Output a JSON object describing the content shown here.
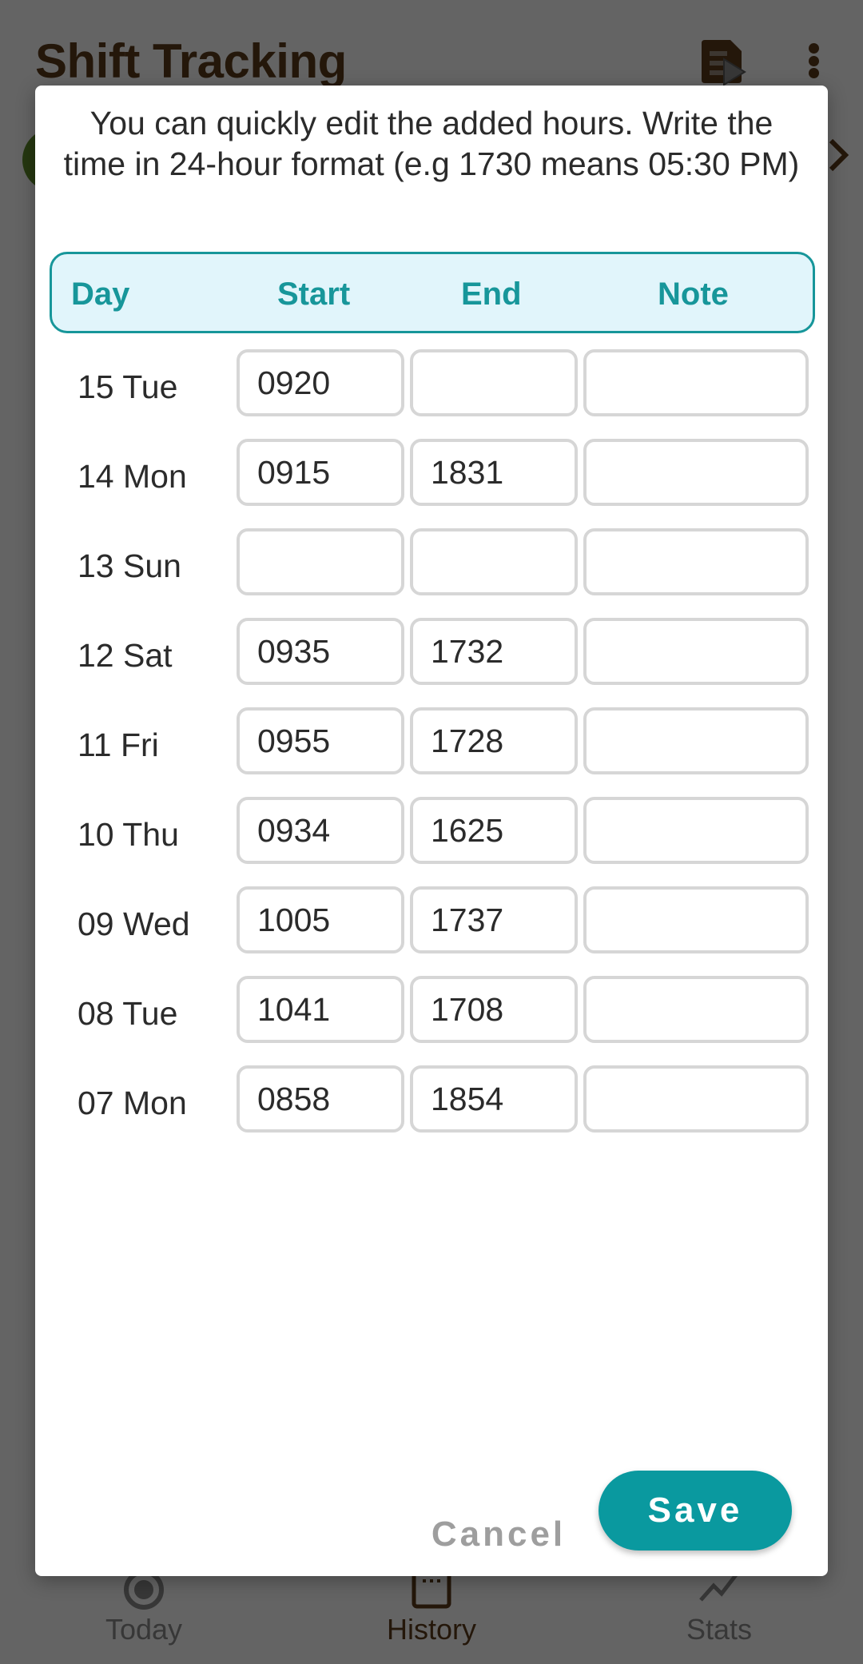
{
  "app": {
    "title": "Shift Tracking",
    "bottom_nav": [
      {
        "label": "Today",
        "icon": "radio-button-icon",
        "active": false
      },
      {
        "label": "History",
        "icon": "calendar-icon",
        "active": true
      },
      {
        "label": "Stats",
        "icon": "trending-icon",
        "active": false
      }
    ]
  },
  "dialog": {
    "intro": "You can quickly edit the added hours. Write the time in 24-hour format (e.g 1730 means 05:30 PM)",
    "headers": {
      "day": "Day",
      "start": "Start",
      "end": "End",
      "note": "Note"
    },
    "rows": [
      {
        "day": "15 Tue",
        "start": "0920",
        "end": "",
        "note": ""
      },
      {
        "day": "14 Mon",
        "start": "0915",
        "end": "1831",
        "note": ""
      },
      {
        "day": "13 Sun",
        "start": "",
        "end": "",
        "note": ""
      },
      {
        "day": "12 Sat",
        "start": "0935",
        "end": "1732",
        "note": ""
      },
      {
        "day": "11 Fri",
        "start": "0955",
        "end": "1728",
        "note": ""
      },
      {
        "day": "10 Thu",
        "start": "0934",
        "end": "1625",
        "note": ""
      },
      {
        "day": "09 Wed",
        "start": "1005",
        "end": "1737",
        "note": ""
      },
      {
        "day": "08 Tue",
        "start": "1041",
        "end": "1708",
        "note": ""
      },
      {
        "day": "07 Mon",
        "start": "0858",
        "end": "1854",
        "note": ""
      }
    ],
    "cancel_label": "Cancel",
    "save_label": "Save"
  },
  "colors": {
    "accent": "#0a999f",
    "header_bg": "#e1f5fb",
    "brand_brown": "#5b3a1a"
  }
}
